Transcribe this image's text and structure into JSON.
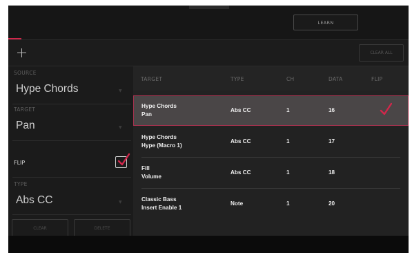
{
  "header": {
    "learn_label": "LEARN"
  },
  "toolbar": {
    "add_icon": "plus-icon",
    "clear_all_label": "CLEAR ALL"
  },
  "left_panel": {
    "source_label": "SOURCE",
    "source_value": "Hype Chords",
    "target_label": "TARGET",
    "target_value": "Pan",
    "flip_label": "FLIP",
    "flip_checked": true,
    "type_label": "TYPE",
    "type_value": "Abs CC",
    "clear_label": "CLEAR",
    "delete_label": "DELETE"
  },
  "table": {
    "columns": [
      "TARGET",
      "TYPE",
      "CH",
      "DATA",
      "FLIP"
    ],
    "rows": [
      {
        "target_line1": "Hype Chords",
        "target_line2": "Pan",
        "type": "Abs CC",
        "ch": "1",
        "data": "16",
        "flip": true,
        "selected": true
      },
      {
        "target_line1": "Hype Chords",
        "target_line2": "Hype (Macro 1)",
        "type": "Abs CC",
        "ch": "1",
        "data": "17",
        "flip": false,
        "selected": false
      },
      {
        "target_line1": "Fill",
        "target_line2": "Volume",
        "type": "Abs CC",
        "ch": "1",
        "data": "18",
        "flip": false,
        "selected": false
      },
      {
        "target_line1": "Classic Bass",
        "target_line2": "Insert Enable 1",
        "type": "Note",
        "ch": "1",
        "data": "20",
        "flip": false,
        "selected": false
      }
    ]
  },
  "colors": {
    "accent": "#d1274b",
    "background": "#181818",
    "selected_row": "#4a4647"
  }
}
